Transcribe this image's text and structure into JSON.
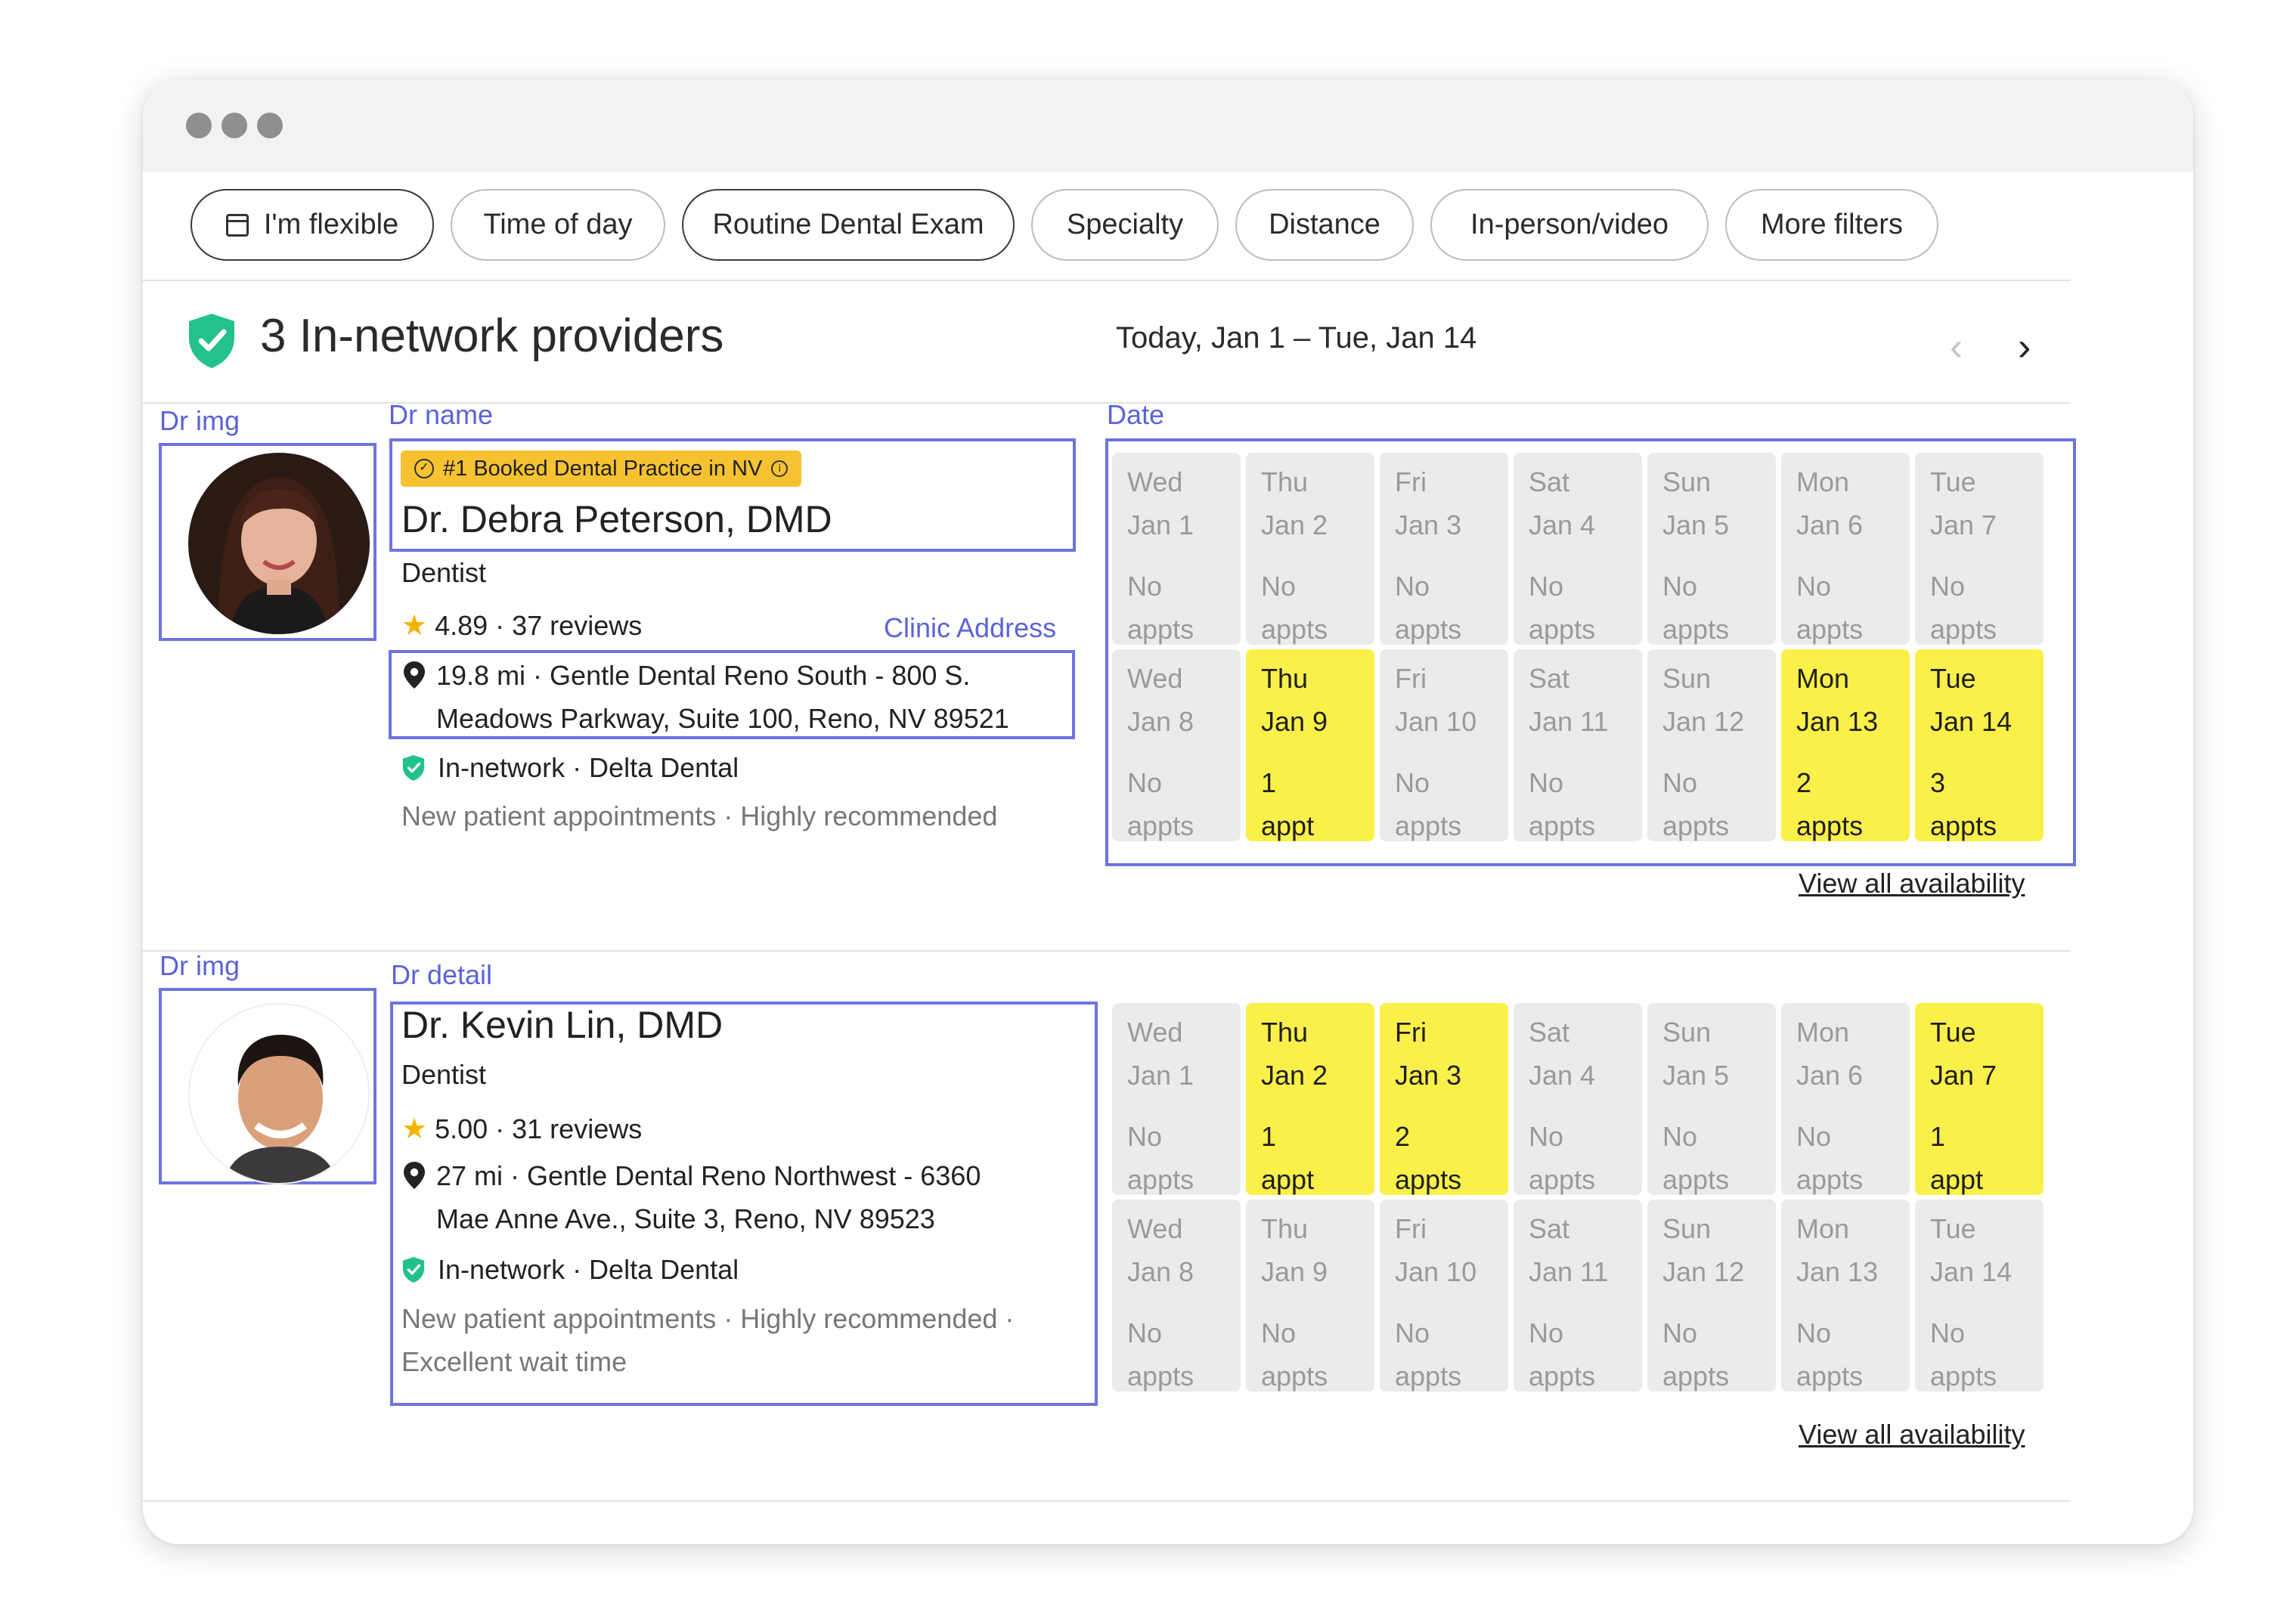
{
  "filters": [
    {
      "label": "I'm flexible",
      "icon": "calendar-icon"
    },
    {
      "label": "Time of day"
    },
    {
      "label": "Routine Dental Exam"
    },
    {
      "label": "Specialty"
    },
    {
      "label": "Distance"
    },
    {
      "label": "In-person/video"
    },
    {
      "label": "More filters"
    }
  ],
  "header": {
    "title": "3 In-network providers",
    "date_range": "Today, Jan 1 – Tue, Jan 14",
    "prev_icon": "chevron-left-icon",
    "next_icon": "chevron-right-icon"
  },
  "annotations": {
    "dr_img_1": "Dr img",
    "dr_name": "Dr name",
    "date": "Date",
    "clinic_address": "Clinic Address",
    "dr_img_2": "Dr img",
    "dr_detail": "Dr detail"
  },
  "providers": [
    {
      "badge": "#1 Booked Dental Practice in NV",
      "name": "Dr. Debra Peterson, DMD",
      "specialty": "Dentist",
      "rating": "4.89 · 37 reviews",
      "address_line1": "19.8 mi · Gentle Dental Reno South - 800 S.",
      "address_line2": "Meadows Parkway, Suite 100, Reno, NV 89521",
      "network": "In-network · Delta Dental",
      "tags_line1": "New patient appointments · Highly recommended",
      "tags_line2": "",
      "view_all": "View all availability",
      "days": [
        {
          "dow": "Wed",
          "date": "Jan 1",
          "c1": "No",
          "c2": "appts",
          "available": false
        },
        {
          "dow": "Thu",
          "date": "Jan 2",
          "c1": "No",
          "c2": "appts",
          "available": false
        },
        {
          "dow": "Fri",
          "date": "Jan 3",
          "c1": "No",
          "c2": "appts",
          "available": false
        },
        {
          "dow": "Sat",
          "date": "Jan 4",
          "c1": "No",
          "c2": "appts",
          "available": false
        },
        {
          "dow": "Sun",
          "date": "Jan 5",
          "c1": "No",
          "c2": "appts",
          "available": false
        },
        {
          "dow": "Mon",
          "date": "Jan 6",
          "c1": "No",
          "c2": "appts",
          "available": false
        },
        {
          "dow": "Tue",
          "date": "Jan 7",
          "c1": "No",
          "c2": "appts",
          "available": false
        },
        {
          "dow": "Wed",
          "date": "Jan 8",
          "c1": "No",
          "c2": "appts",
          "available": false
        },
        {
          "dow": "Thu",
          "date": "Jan 9",
          "c1": "1",
          "c2": "appt",
          "available": true
        },
        {
          "dow": "Fri",
          "date": "Jan 10",
          "c1": "No",
          "c2": "appts",
          "available": false
        },
        {
          "dow": "Sat",
          "date": "Jan 11",
          "c1": "No",
          "c2": "appts",
          "available": false
        },
        {
          "dow": "Sun",
          "date": "Jan 12",
          "c1": "No",
          "c2": "appts",
          "available": false
        },
        {
          "dow": "Mon",
          "date": "Jan 13",
          "c1": "2",
          "c2": "appts",
          "available": true
        },
        {
          "dow": "Tue",
          "date": "Jan 14",
          "c1": "3",
          "c2": "appts",
          "available": true
        }
      ]
    },
    {
      "badge": "",
      "name": "Dr. Kevin Lin, DMD",
      "specialty": "Dentist",
      "rating": "5.00 · 31 reviews",
      "address_line1": "27 mi · Gentle Dental Reno Northwest - 6360",
      "address_line2": "Mae Anne Ave., Suite 3, Reno, NV 89523",
      "network": "In-network · Delta Dental",
      "tags_line1": "New patient appointments · Highly recommended ·",
      "tags_line2": "Excellent wait time",
      "view_all": "View all availability",
      "days": [
        {
          "dow": "Wed",
          "date": "Jan 1",
          "c1": "No",
          "c2": "appts",
          "available": false
        },
        {
          "dow": "Thu",
          "date": "Jan 2",
          "c1": "1",
          "c2": "appt",
          "available": true
        },
        {
          "dow": "Fri",
          "date": "Jan 3",
          "c1": "2",
          "c2": "appts",
          "available": true
        },
        {
          "dow": "Sat",
          "date": "Jan 4",
          "c1": "No",
          "c2": "appts",
          "available": false
        },
        {
          "dow": "Sun",
          "date": "Jan 5",
          "c1": "No",
          "c2": "appts",
          "available": false
        },
        {
          "dow": "Mon",
          "date": "Jan 6",
          "c1": "No",
          "c2": "appts",
          "available": false
        },
        {
          "dow": "Tue",
          "date": "Jan 7",
          "c1": "1",
          "c2": "appt",
          "available": true
        },
        {
          "dow": "Wed",
          "date": "Jan 8",
          "c1": "No",
          "c2": "appts",
          "available": false
        },
        {
          "dow": "Thu",
          "date": "Jan 9",
          "c1": "No",
          "c2": "appts",
          "available": false
        },
        {
          "dow": "Fri",
          "date": "Jan 10",
          "c1": "No",
          "c2": "appts",
          "available": false
        },
        {
          "dow": "Sat",
          "date": "Jan 11",
          "c1": "No",
          "c2": "appts",
          "available": false
        },
        {
          "dow": "Sun",
          "date": "Jan 12",
          "c1": "No",
          "c2": "appts",
          "available": false
        },
        {
          "dow": "Mon",
          "date": "Jan 13",
          "c1": "No",
          "c2": "appts",
          "available": false
        },
        {
          "dow": "Tue",
          "date": "Jan 14",
          "c1": "No",
          "c2": "appts",
          "available": false
        }
      ]
    }
  ],
  "colors": {
    "available": "#fbf04a",
    "unavailable": "#ebebeb",
    "annotation": "#5b63d8",
    "badge": "#f6c232",
    "shield": "#22c28a"
  }
}
